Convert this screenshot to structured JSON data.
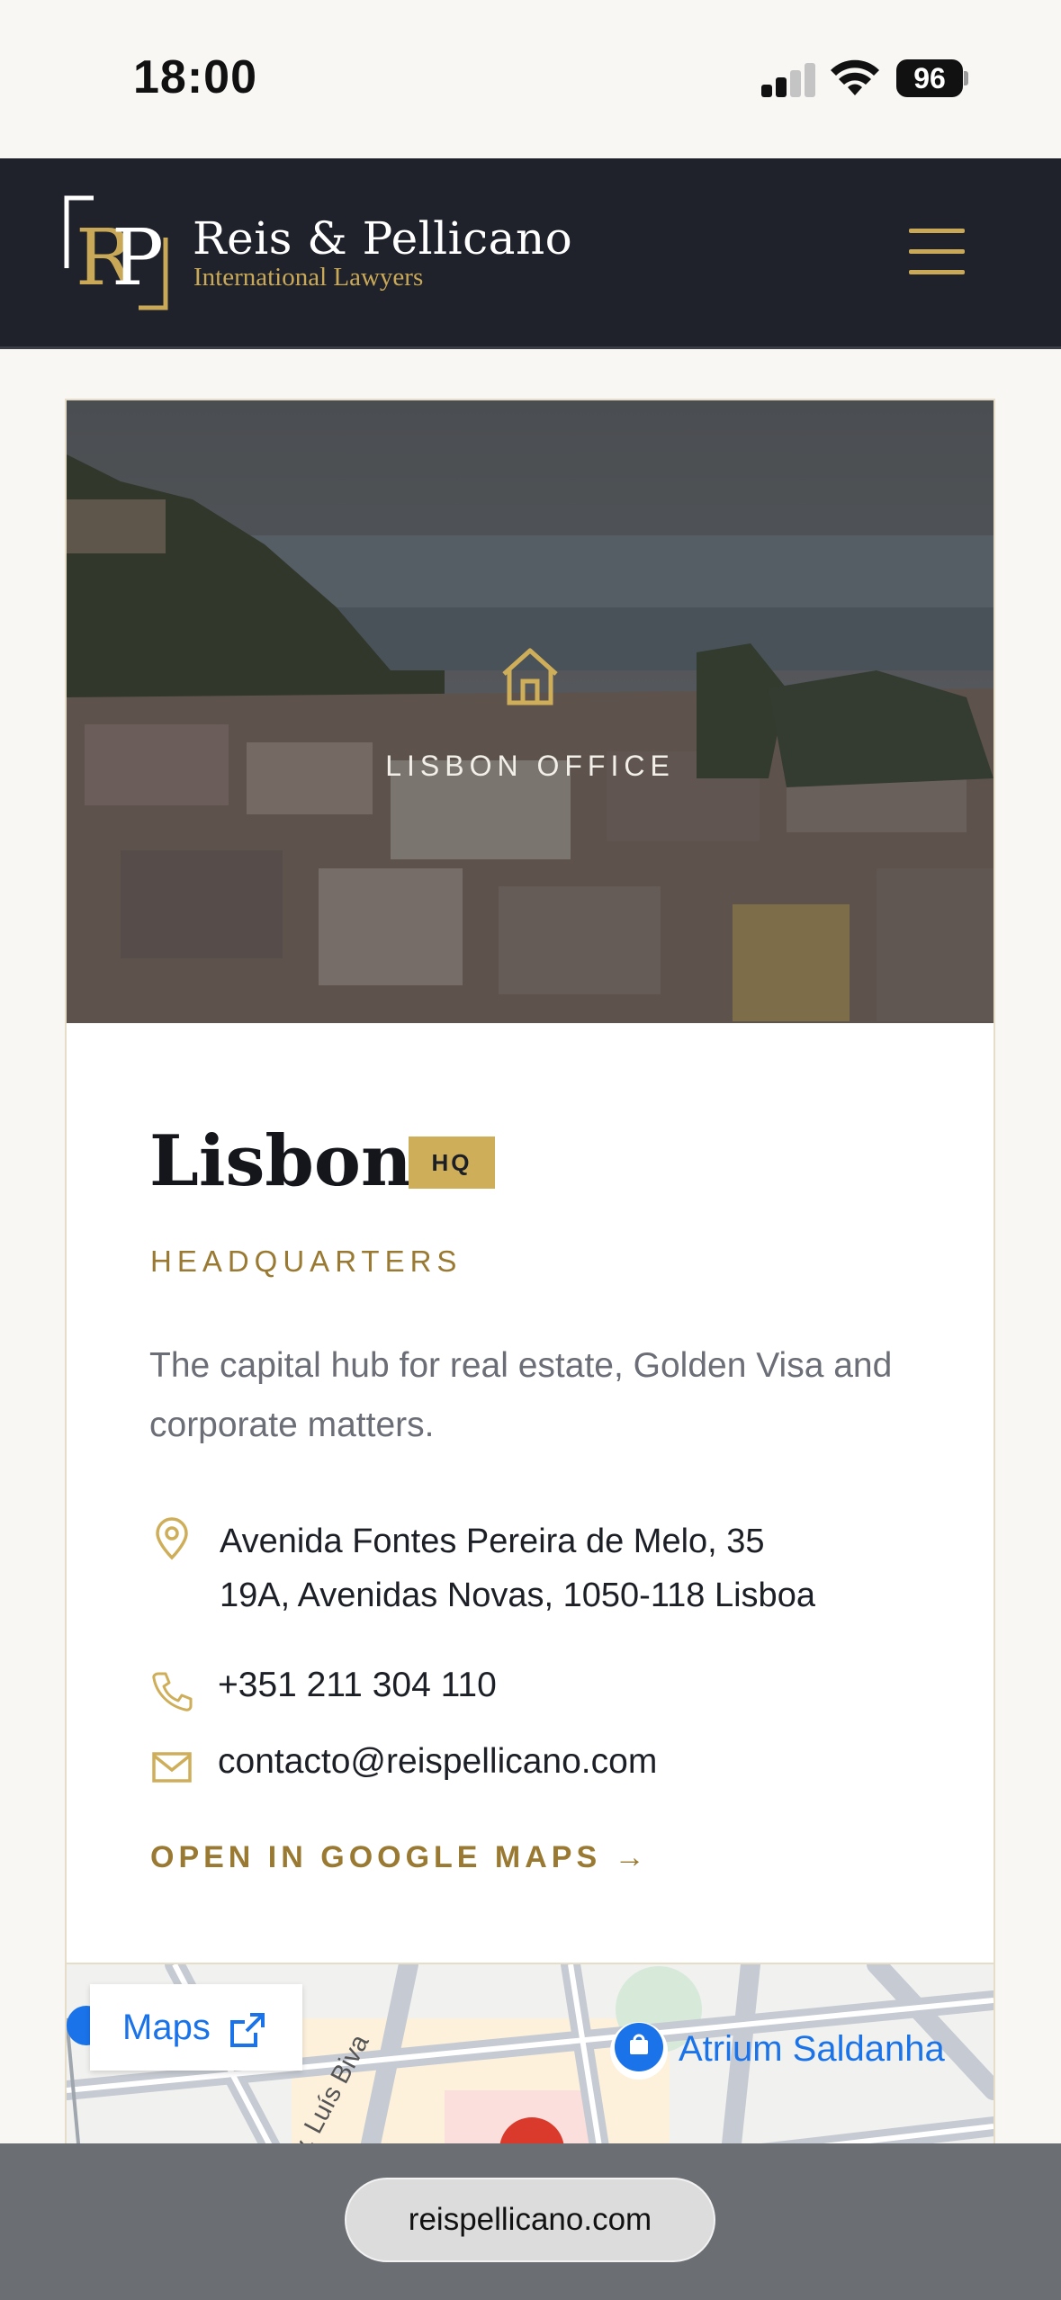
{
  "status_bar": {
    "time": "18:00",
    "battery": "96"
  },
  "header": {
    "brand_name": "Reis & Pellicano",
    "brand_tagline": "International Lawyers",
    "accent_color": "#c9a957",
    "background_color": "#1f222b"
  },
  "office": {
    "hero_label": "LISBON OFFICE",
    "hero_icon": "home-icon",
    "name": "Lisbon",
    "badge": "HQ",
    "subtitle": "HEADQUARTERS",
    "description": "The capital hub for real estate, Golden Visa and corporate matters.",
    "address_line1": "Avenida Fontes Pereira de Melo, 35",
    "address_line2": "19A, Avenidas Novas, 1050-118 Lisboa",
    "phone": "+351 211 304 110",
    "email": "contacto@reispellicano.com",
    "maps_link": "OPEN IN GOOGLE MAPS →"
  },
  "map": {
    "badge_label": "Maps",
    "place_label": "Atrium Saldanha",
    "street_label": "Av. Luís Biva"
  },
  "browser": {
    "url": "reispellicano.com"
  }
}
